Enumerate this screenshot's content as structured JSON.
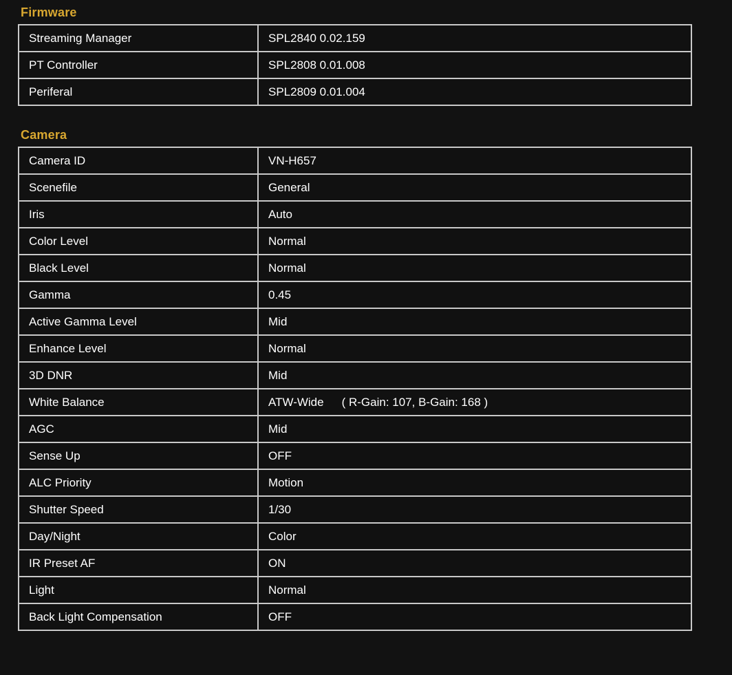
{
  "sections": [
    {
      "title": "Firmware",
      "name": "firmware",
      "rows": [
        {
          "key": "Streaming Manager",
          "value": "SPL2840 0.02.159"
        },
        {
          "key": "PT Controller",
          "value": "SPL2808 0.01.008"
        },
        {
          "key": "Periferal",
          "value": "SPL2809 0.01.004"
        }
      ]
    },
    {
      "title": "Camera",
      "name": "camera",
      "rows": [
        {
          "key": "Camera ID",
          "value": "VN-H657"
        },
        {
          "key": "Scenefile",
          "value": "General"
        },
        {
          "key": "Iris",
          "value": "Auto"
        },
        {
          "key": "Color Level",
          "value": "Normal"
        },
        {
          "key": "Black Level",
          "value": "Normal"
        },
        {
          "key": "Gamma",
          "value": "0.45"
        },
        {
          "key": "Active Gamma Level",
          "value": "Mid"
        },
        {
          "key": "Enhance Level",
          "value": "Normal"
        },
        {
          "key": "3D DNR",
          "value": "Mid"
        },
        {
          "key": "White Balance",
          "value": "ATW-Wide",
          "value_extra": "( R-Gain: 107, B-Gain: 168 )"
        },
        {
          "key": "AGC",
          "value": "Mid"
        },
        {
          "key": "Sense Up",
          "value": "OFF"
        },
        {
          "key": "ALC Priority",
          "value": "Motion"
        },
        {
          "key": "Shutter Speed",
          "value": "1/30"
        },
        {
          "key": "Day/Night",
          "value": "Color"
        },
        {
          "key": "IR Preset AF",
          "value": "ON"
        },
        {
          "key": "Light",
          "value": "Normal"
        },
        {
          "key": "Back Light Compensation",
          "value": "OFF"
        }
      ]
    }
  ],
  "colors": {
    "background": "#121212",
    "cell_background": "#111111",
    "border": "#c9c9c9",
    "section_title": "#d8a730",
    "text": "#ffffff"
  }
}
